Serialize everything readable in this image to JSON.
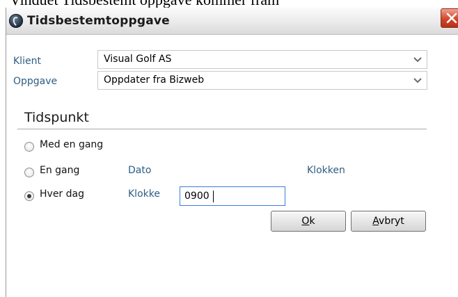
{
  "document": {
    "caption": "Vinduet Tidsbestemt oppgave kommer fram"
  },
  "window": {
    "title": "Tidsbestemtoppgave"
  },
  "form": {
    "klient_label": "Klient",
    "klient_value": "Visual Golf AS",
    "oppgave_label": "Oppgave",
    "oppgave_value": "Oppdater fra Bizweb"
  },
  "tidspunkt": {
    "section_title": "Tidspunkt",
    "options": [
      {
        "label": "Med en gang",
        "checked": false
      },
      {
        "label": "En gang",
        "checked": false
      },
      {
        "label": "Hver dag",
        "checked": true
      }
    ],
    "dato_label": "Dato",
    "klokken_label": "Klokken",
    "klokke_label": "Klokke",
    "klokke_value": "0900"
  },
  "buttons": {
    "ok_mnemonic": "O",
    "ok_rest": "k",
    "avbryt_mnemonic": "A",
    "avbryt_rest": "vbryt"
  },
  "icons": {
    "title": "app-logo-icon",
    "close": "close-icon",
    "dropdown": "chevron-down-icon"
  }
}
